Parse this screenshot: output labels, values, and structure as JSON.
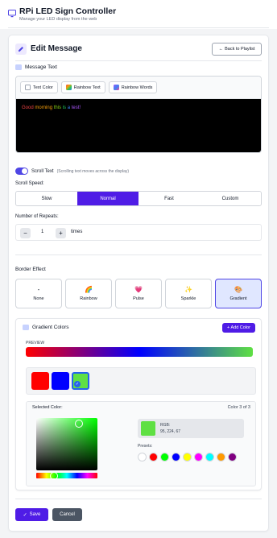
{
  "header": {
    "title": "RPi LED Sign Controller",
    "subtitle": "Manage your LED display from the web",
    "logo_icon": "monitor-icon"
  },
  "editor_card": {
    "title": "Edit Message",
    "edit_icon": "pencil-icon",
    "back_label": "Back to Playlist",
    "back_icon": "arrow-left-icon",
    "message_text_label": "Message Text",
    "toolbar": {
      "text_color": "Text Color",
      "rainbow_text": "Rainbow Text",
      "rainbow_words": "Rainbow Words"
    },
    "message_segments": [
      {
        "text": "Good ",
        "color": "#ef4444"
      },
      {
        "text": "morning ",
        "color": "#f59e0b"
      },
      {
        "text": "this ",
        "color": "#84cc16"
      },
      {
        "text": "is ",
        "color": "#22c55e"
      },
      {
        "text": "a ",
        "color": "#3b82f6"
      },
      {
        "text": "test!",
        "color": "#a855f7"
      }
    ],
    "scroll": {
      "label": "Scroll Text",
      "hint": "(Scrolling text moves across the display)",
      "enabled": true
    },
    "speed": {
      "label": "Scroll Speed:",
      "options": [
        "Slow",
        "Normal",
        "Fast",
        "Custom"
      ],
      "selected": "Normal"
    },
    "repeats": {
      "label": "Number of Repeats:",
      "value": "1",
      "unit": "times",
      "minus": "−",
      "plus": "+"
    },
    "border": {
      "label": "Border Effect",
      "options": [
        {
          "glyph": "-",
          "label": "None"
        },
        {
          "glyph": "🌈",
          "label": "Rainbow"
        },
        {
          "glyph": "💗",
          "label": "Pulse"
        },
        {
          "glyph": "✨",
          "label": "Sparkle"
        },
        {
          "glyph": "🎨",
          "label": "Gradient"
        }
      ],
      "selected": "Gradient"
    },
    "gradient": {
      "title": "Gradient Colors",
      "add_label": "+ Add Color",
      "preview_label": "PREVIEW",
      "stops": [
        "#ff0000",
        "#0000ff",
        "#5fe043"
      ],
      "selected_index": 2,
      "selected_color_label": "Selected Color:",
      "color_index_label": "Color 3 of 3",
      "selected_hex": "#5fe043",
      "rgb_label": "RGB:",
      "rgb_value": "95, 224, 67",
      "presets_label": "Presets:",
      "presets": [
        "#ffffff",
        "#ff0000",
        "#00ff00",
        "#0000ff",
        "#ffff00",
        "#ff00ff",
        "#00ffff",
        "#ff9900",
        "#800080"
      ]
    },
    "actions": {
      "save": "Save",
      "cancel": "Cancel"
    }
  },
  "colors": {
    "accent": "#4f1ce6"
  }
}
